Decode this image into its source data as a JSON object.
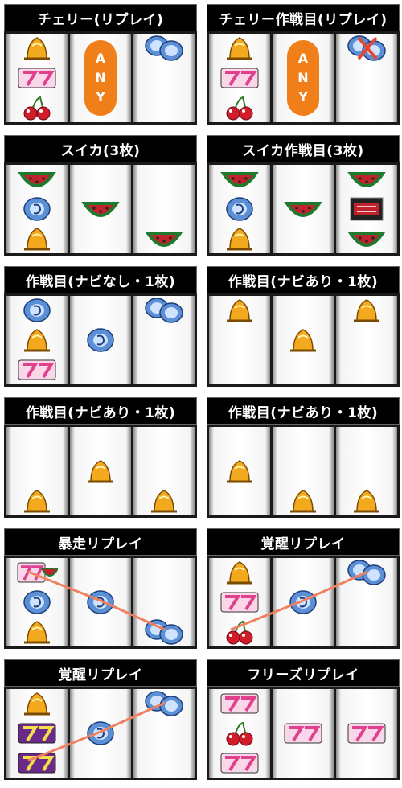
{
  "colors": {
    "title_bg": "#000000",
    "title_text": "#ffffff",
    "any_badge": "#f07f1a",
    "line": "#f08060"
  },
  "panels": [
    {
      "title": "チェリー(リプレイ)",
      "reels": [
        [
          "bell",
          "seven",
          "cherry"
        ],
        [
          "any"
        ],
        [
          "replay-double"
        ]
      ]
    },
    {
      "title": "チェリー作戦目(リプレイ)",
      "reels": [
        [
          "bell",
          "seven",
          "cherry"
        ],
        [
          "any"
        ],
        [
          "replay-crossed"
        ]
      ]
    },
    {
      "title": "スイカ(3枚)",
      "reels": [
        [
          "watermelon",
          "replay",
          "bell"
        ],
        [
          "none",
          "watermelon",
          "none"
        ],
        [
          "none",
          "none",
          "watermelon"
        ]
      ]
    },
    {
      "title": "スイカ作戦目(3枚)",
      "reels": [
        [
          "watermelon",
          "replay",
          "bell"
        ],
        [
          "none",
          "watermelon",
          "none"
        ],
        [
          "watermelon",
          "bar",
          "watermelon"
        ]
      ]
    },
    {
      "title": "作戦目(ナビなし・1枚)",
      "reels": [
        [
          "replay",
          "bell",
          "seven"
        ],
        [
          "none",
          "replay",
          "none"
        ],
        [
          "replay-double",
          "none",
          "none"
        ]
      ]
    },
    {
      "title": "作戦目(ナビあり・1枚)",
      "reels": [
        [
          "bell",
          "none",
          "none"
        ],
        [
          "none",
          "bell",
          "none"
        ],
        [
          "bell",
          "none",
          "none"
        ]
      ]
    },
    {
      "title": "作戦目(ナビあり・1枚)",
      "reels": [
        [
          "none",
          "none",
          "bell"
        ],
        [
          "none",
          "bell",
          "none"
        ],
        [
          "none",
          "none",
          "bell"
        ]
      ]
    },
    {
      "title": "作戦目(ナビあり・1枚)",
      "reels": [
        [
          "none",
          "bell",
          "none"
        ],
        [
          "none",
          "none",
          "bell"
        ],
        [
          "none",
          "none",
          "bell"
        ]
      ]
    },
    {
      "title": "暴走リプレイ",
      "reels": [
        [
          "seven-watermelon",
          "replay",
          "bell"
        ],
        [
          "none",
          "replay",
          "none"
        ],
        [
          "none",
          "none",
          "replay-double"
        ]
      ],
      "line": "down"
    },
    {
      "title": "覚醒リプレイ",
      "reels": [
        [
          "bell",
          "seven",
          "cherry"
        ],
        [
          "none",
          "replay",
          "none"
        ],
        [
          "replay-double",
          "none",
          "none"
        ]
      ],
      "line": "up"
    },
    {
      "title": "覚醒リプレイ",
      "reels": [
        [
          "bell",
          "seven-purple",
          "seven-purple"
        ],
        [
          "none",
          "replay",
          "none"
        ],
        [
          "replay-double",
          "none",
          "none"
        ]
      ],
      "line": "up"
    },
    {
      "title": "フリーズリプレイ",
      "reels": [
        [
          "seven",
          "cherry",
          "seven"
        ],
        [
          "none",
          "seven",
          "none"
        ],
        [
          "none",
          "seven",
          "none"
        ]
      ]
    }
  ],
  "any_letters": [
    "A",
    "N",
    "Y"
  ]
}
